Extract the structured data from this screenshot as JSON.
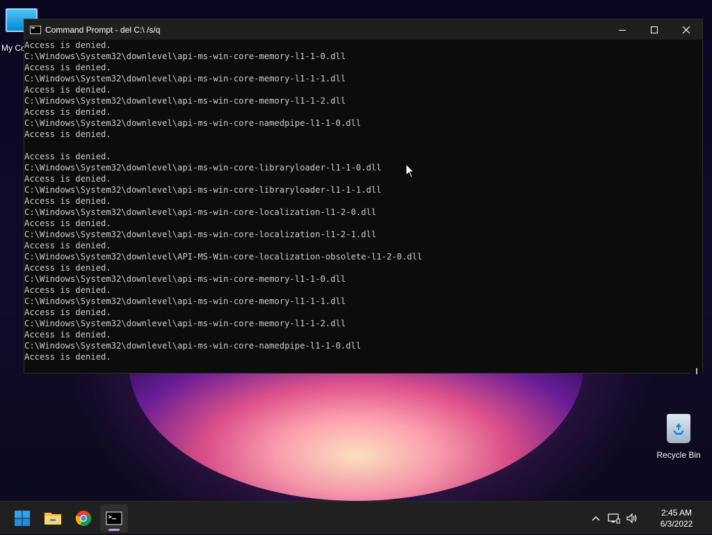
{
  "desktop": {
    "icons": {
      "my_computer": "My Co",
      "recycle_bin": "Recycle Bin"
    }
  },
  "window": {
    "title": "Command Prompt - del  C:\\ /s/q",
    "controls": {
      "minimize": "–",
      "maximize": "☐",
      "close": "✕"
    }
  },
  "console": {
    "lines": [
      "Access is denied.",
      "C:\\Windows\\System32\\downlevel\\api-ms-win-core-memory-l1-1-0.dll",
      "Access is denied.",
      "C:\\Windows\\System32\\downlevel\\api-ms-win-core-memory-l1-1-1.dll",
      "Access is denied.",
      "C:\\Windows\\System32\\downlevel\\api-ms-win-core-memory-l1-1-2.dll",
      "Access is denied.",
      "C:\\Windows\\System32\\downlevel\\api-ms-win-core-namedpipe-l1-1-0.dll",
      "Access is denied.",
      "",
      "Access is denied.",
      "C:\\Windows\\System32\\downlevel\\api-ms-win-core-libraryloader-l1-1-0.dll",
      "Access is denied.",
      "C:\\Windows\\System32\\downlevel\\api-ms-win-core-libraryloader-l1-1-1.dll",
      "Access is denied.",
      "C:\\Windows\\System32\\downlevel\\api-ms-win-core-localization-l1-2-0.dll",
      "Access is denied.",
      "C:\\Windows\\System32\\downlevel\\api-ms-win-core-localization-l1-2-1.dll",
      "Access is denied.",
      "C:\\Windows\\System32\\downlevel\\API-MS-Win-core-localization-obsolete-l1-2-0.dll",
      "Access is denied.",
      "C:\\Windows\\System32\\downlevel\\api-ms-win-core-memory-l1-1-0.dll",
      "Access is denied.",
      "C:\\Windows\\System32\\downlevel\\api-ms-win-core-memory-l1-1-1.dll",
      "Access is denied.",
      "C:\\Windows\\System32\\downlevel\\api-ms-win-core-memory-l1-1-2.dll",
      "Access is denied.",
      "C:\\Windows\\System32\\downlevel\\api-ms-win-core-namedpipe-l1-1-0.dll",
      "Access is denied."
    ]
  },
  "taskbar": {
    "apps": [
      "start-icon",
      "file-explorer-icon",
      "chrome-icon",
      "command-prompt-icon"
    ],
    "tray": {
      "time": "2:45 AM",
      "date": "6/3/2022"
    }
  },
  "colors": {
    "console_bg": "#0c0c0c",
    "console_text": "#cccccc",
    "titlebar": "#1f1f1f",
    "taskbar": "#202020",
    "windows_blue": "#0078d4"
  }
}
